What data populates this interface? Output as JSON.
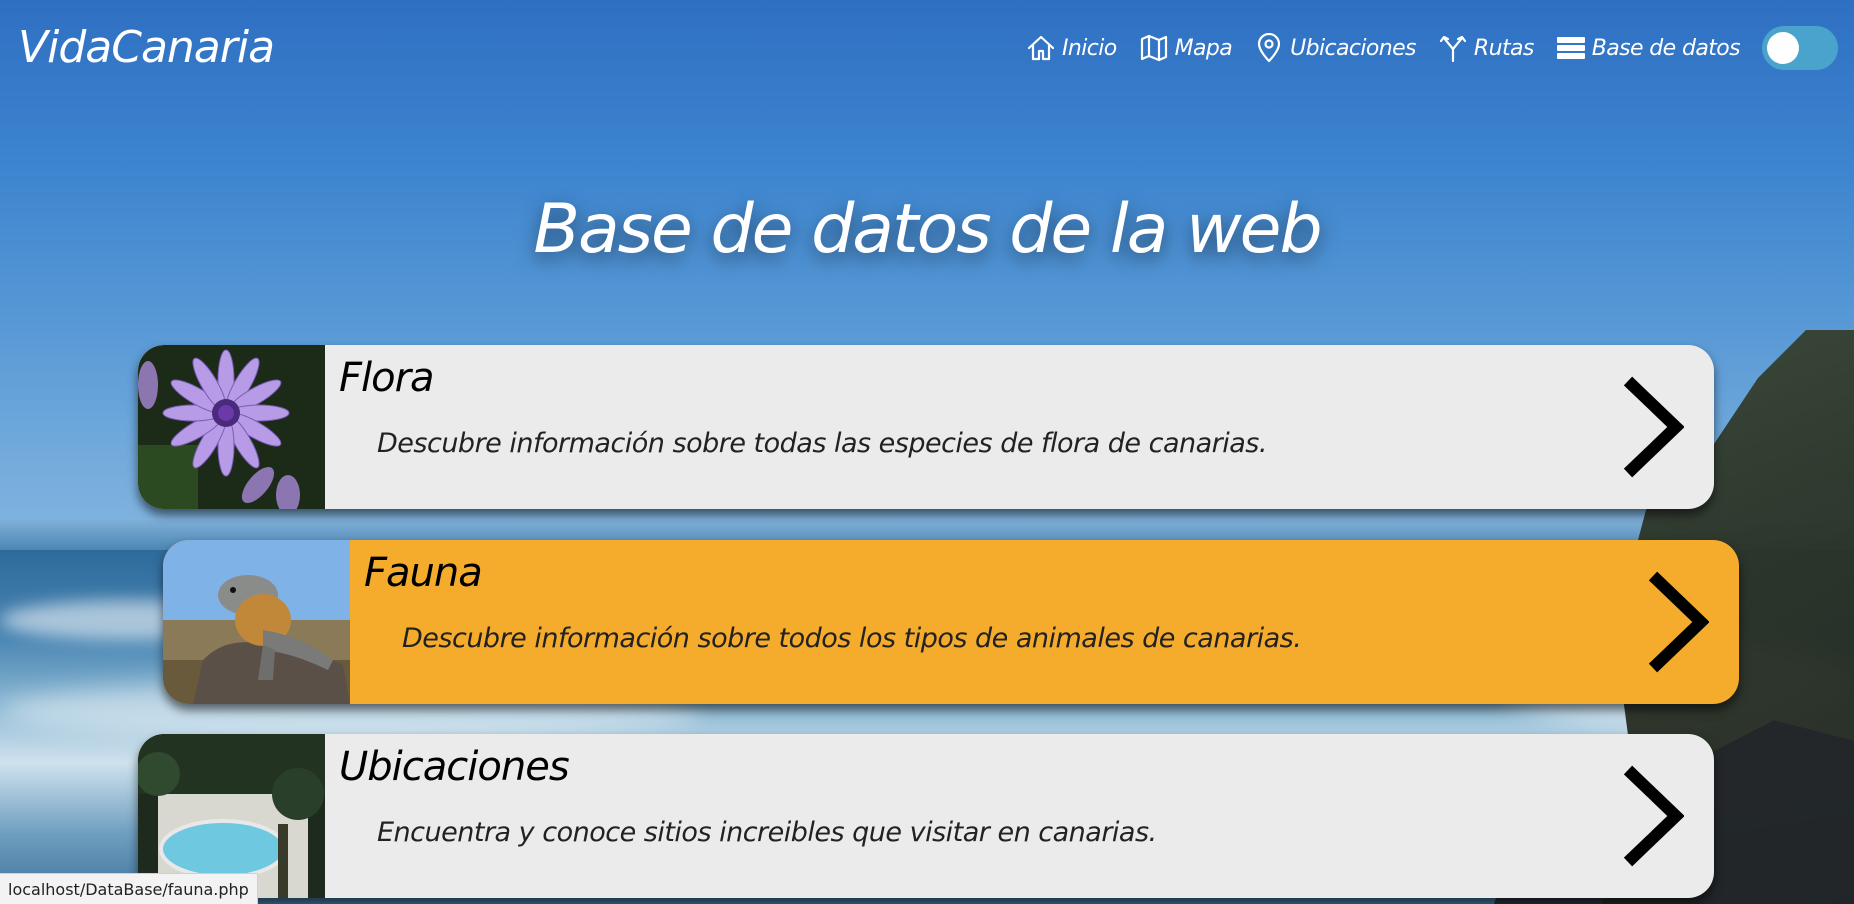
{
  "header": {
    "logo": "VidaCanaria",
    "nav": [
      {
        "label": "Inicio",
        "icon": "home-icon"
      },
      {
        "label": "Mapa",
        "icon": "map-icon"
      },
      {
        "label": "Ubicaciones",
        "icon": "location-pin-icon"
      },
      {
        "label": "Rutas",
        "icon": "route-fork-icon"
      },
      {
        "label": "Base de datos",
        "icon": "database-icon"
      }
    ],
    "toggle": {
      "state": "off"
    }
  },
  "main": {
    "title": "Base de datos de la web",
    "cards": [
      {
        "title": "Flora",
        "description": "Descubre información sobre todas las especies de flora de canarias.",
        "image": "purple-flower",
        "highlighted": false
      },
      {
        "title": "Fauna",
        "description": "Descubre información sobre todos los tipos de animales de canarias.",
        "image": "lizard",
        "highlighted": true
      },
      {
        "title": "Ubicaciones",
        "description": "Encuentra y conoce sitios increibles que visitar en canarias.",
        "image": "pool",
        "highlighted": false
      }
    ]
  },
  "status_bar": {
    "url": "localhost/DataBase/fauna.php"
  },
  "colors": {
    "highlight": "#f5ab2c",
    "card": "#ebebeb",
    "toggle": "#4aa3cc"
  }
}
